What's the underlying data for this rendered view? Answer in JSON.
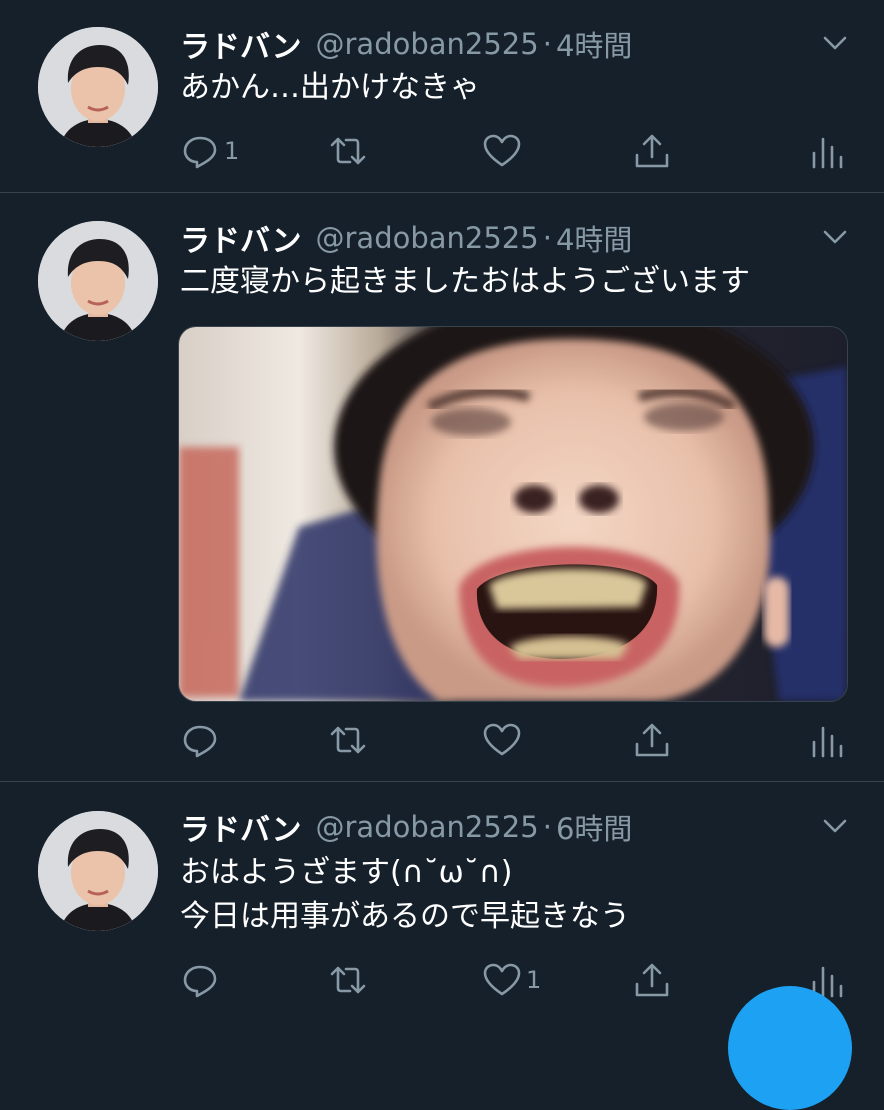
{
  "tweets": [
    {
      "name": "ラドバン",
      "handle": "@radoban2525",
      "separator": "·",
      "time": "4時間",
      "lines": [
        "あかん…出かけなきゃ"
      ],
      "reply_count": "1",
      "like_count": ""
    },
    {
      "name": "ラドバン",
      "handle": "@radoban2525",
      "separator": "·",
      "time": "4時間",
      "lines": [
        "二度寝から起きましたおはようございます"
      ],
      "reply_count": "",
      "like_count": ""
    },
    {
      "name": "ラドバン",
      "handle": "@radoban2525",
      "separator": "·",
      "time": "6時間",
      "lines": [
        "おはようざます(∩˘ω˘∩)",
        "今日は用事があるので早起きなう"
      ],
      "reply_count": "",
      "like_count": "1"
    }
  ],
  "icons": {
    "reply": "reply-icon",
    "retweet": "retweet-icon",
    "like": "heart-icon",
    "share": "share-icon",
    "analytics": "analytics-icon",
    "menu": "chevron-down-icon"
  },
  "colors": {
    "background": "#15202b",
    "divider": "#38444d",
    "secondary_text": "#8899a6",
    "accent": "#1da1f2"
  }
}
